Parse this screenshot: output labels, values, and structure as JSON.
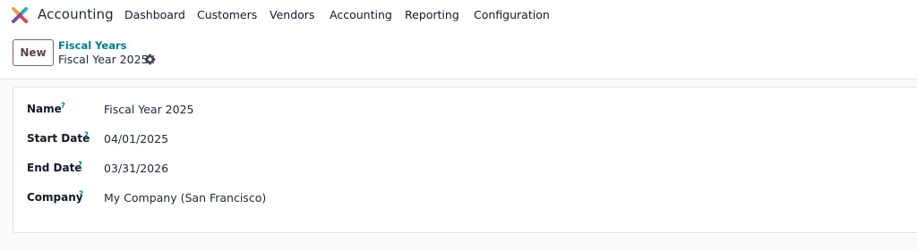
{
  "app": {
    "name": "Accounting",
    "logo_icon": "accounting-app-icon"
  },
  "menu": [
    "Dashboard",
    "Customers",
    "Vendors",
    "Accounting",
    "Reporting",
    "Configuration"
  ],
  "control_panel": {
    "new_label": "New",
    "breadcrumb_parent": "Fiscal Years",
    "breadcrumb_current": "Fiscal Year 2025",
    "settings_icon": "gear-icon"
  },
  "form": {
    "help_mark": "?",
    "fields": [
      {
        "label": "Name",
        "value": "Fiscal Year 2025"
      },
      {
        "label": "Start Date",
        "value": "04/01/2025"
      },
      {
        "label": "End Date",
        "value": "03/31/2026"
      },
      {
        "label": "Company",
        "value": "My Company (San Francisco)"
      }
    ]
  },
  "colors": {
    "link": "#017e84",
    "primary_border": "#8a5a7a",
    "page_background": "#f9fafb"
  }
}
